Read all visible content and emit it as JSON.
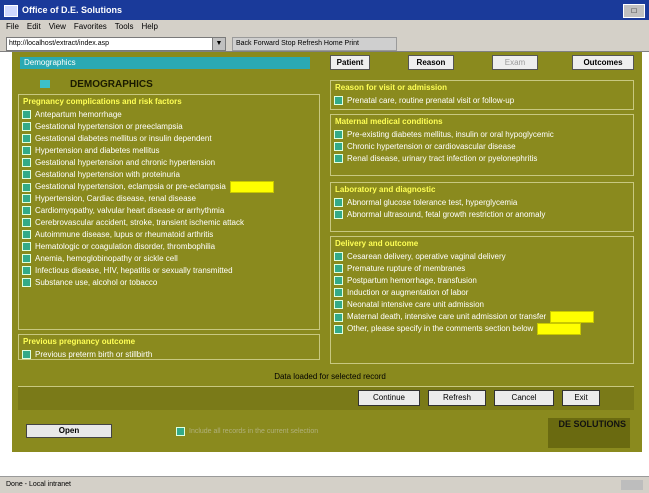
{
  "window": {
    "title": "Office of D.E. Solutions"
  },
  "menu": [
    "File",
    "Edit",
    "View",
    "Favorites",
    "Tools",
    "Help"
  ],
  "toolbar": {
    "address": "http://localhost/extract/index.asp",
    "icons_text": "Back Forward Stop Refresh Home Print"
  },
  "tabs": {
    "active": "Demographics",
    "buttons": [
      {
        "label": "Patient",
        "enabled": true
      },
      {
        "label": "Reason",
        "enabled": true
      },
      {
        "label": "Exam",
        "enabled": false
      },
      {
        "label": "Outcomes",
        "enabled": true
      }
    ]
  },
  "panel_title": "DEMOGRAPHICS",
  "left_sections": [
    {
      "title": "Pregnancy complications and risk factors",
      "items": [
        "Antepartum hemorrhage",
        "Gestational hypertension or preeclampsia",
        "Gestational diabetes mellitus or insulin dependent",
        "Hypertension and diabetes mellitus",
        "Gestational hypertension and chronic hypertension",
        "Gestational hypertension with proteinuria",
        "Gestational hypertension, eclampsia or pre-eclampsia",
        "Hypertension, Cardiac disease, renal disease",
        "Cardiomyopathy, valvular heart disease or arrhythmia",
        "Cerebrovascular accident, stroke, transient ischemic attack",
        "Autoimmune disease, lupus or rheumatoid arthritis",
        "Hematologic or coagulation disorder, thrombophilia",
        "Anemia, hemoglobinopathy or sickle cell",
        "Infectious disease, HIV, hepatitis or sexually transmitted",
        "Substance use, alcohol or tobacco"
      ],
      "field_item_index": 6
    },
    {
      "title": "Previous pregnancy outcome",
      "items": [
        "Previous preterm birth or stillbirth"
      ]
    }
  ],
  "right_sections": [
    {
      "title": "Reason for visit or admission",
      "items": [
        "Prenatal care, routine prenatal visit or follow-up"
      ]
    },
    {
      "title": "Maternal medical conditions",
      "items": [
        "Pre-existing diabetes mellitus, insulin or oral hypoglycemic",
        "Chronic hypertension or cardiovascular disease",
        "Renal disease, urinary tract infection or pyelonephritis"
      ]
    },
    {
      "title": "Laboratory and diagnostic",
      "items": [
        "Abnormal glucose tolerance test, hyperglycemia",
        "Abnormal ultrasound, fetal growth restriction or anomaly"
      ]
    },
    {
      "title": "Delivery and outcome",
      "items": [
        "Cesarean delivery, operative vaginal delivery",
        "Premature rupture of membranes",
        "Postpartum hemorrhage, transfusion",
        "Induction or augmentation of labor",
        "Neonatal intensive care unit admission",
        "Maternal death, intensive care unit admission or transfer",
        "Other, please specify in the comments section below"
      ],
      "field_item_indices": [
        5,
        6
      ]
    }
  ],
  "status_message": "Data loaded for selected record",
  "buttons": [
    "Continue",
    "Refresh",
    "Cancel",
    "Exit"
  ],
  "open_button": "Open",
  "option_label": "Include all records in the current selection",
  "logo_text": "DE SOLUTIONS",
  "statusbar_text": "Done - Local intranet",
  "colors": {
    "panel": "#8a8a1e",
    "accent": "#2aa9b3",
    "highlight": "#ffff00",
    "section_title": "#ffff55"
  }
}
